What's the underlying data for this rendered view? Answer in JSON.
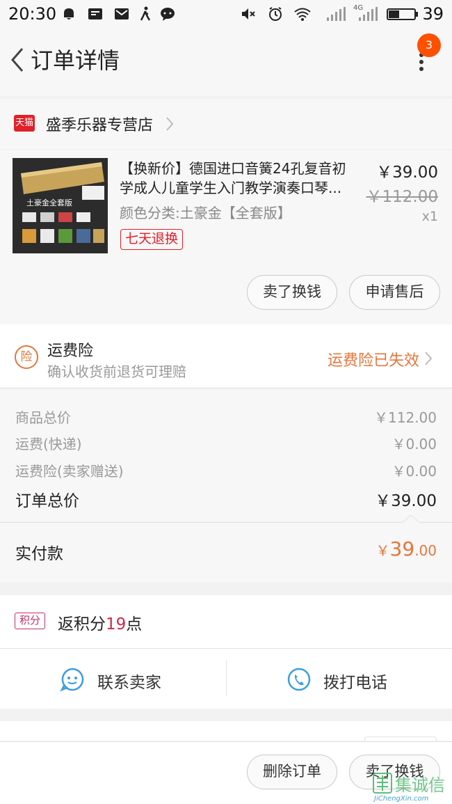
{
  "status_bar": {
    "time": "20:30",
    "battery": "39",
    "network": "4G"
  },
  "header": {
    "title": "订单详情",
    "badge": "3"
  },
  "shop": {
    "icon_text": "天猫",
    "name": "盛季乐器专营店"
  },
  "item": {
    "title_line1": "【换新价】德国进口音簧24孔复音初",
    "title_line2": "学成人儿童学生入门教学演奏口琴...",
    "thumb_caption": "土豪金全套版",
    "sku": "颜色分类:土豪金【全套版】",
    "tag": "七天退换",
    "price_now": "￥39.00",
    "price_old": "￥112.00",
    "qty": "x1"
  },
  "item_actions": {
    "sell": "卖了换钱",
    "after_sale": "申请售后"
  },
  "insurance": {
    "icon": "险",
    "title": "运费险",
    "subtitle": "确认收货前退货可理赔",
    "status": "运费险已失效"
  },
  "summary": {
    "rows": [
      {
        "label": "商品总价",
        "value": "￥112.00"
      },
      {
        "label": "运费(快递)",
        "value": "￥0.00"
      },
      {
        "label": "运费险(卖家赠送)",
        "value": "￥0.00"
      }
    ],
    "total_label": "订单总价",
    "total_value": "￥39.00"
  },
  "paid": {
    "label": "实付款",
    "currency": "￥",
    "integer": "39",
    "decimal": ".00"
  },
  "points": {
    "icon": "积分",
    "prefix": "返积分",
    "count": "19",
    "suffix": "点"
  },
  "contact": {
    "seller": "联系卖家",
    "call": "拨打电话"
  },
  "bottom_actions": {
    "delete": "删除订单",
    "sell": "卖了换钱"
  },
  "watermark": {
    "brand": "集诚信",
    "url": "JiChengXin.com"
  },
  "colors": {
    "accent": "#e5763a",
    "tmall": "#e0202a",
    "badge": "#ff5000",
    "points": "#d0284a"
  }
}
